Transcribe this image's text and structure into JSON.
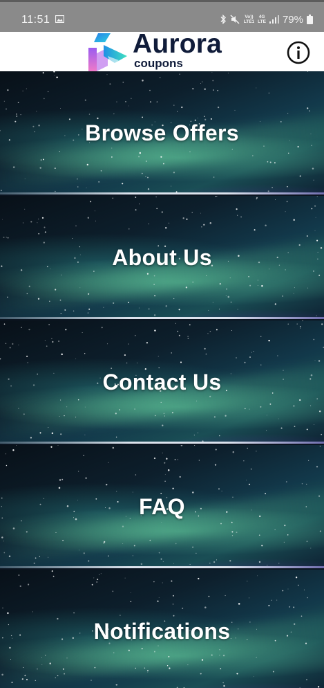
{
  "status_bar": {
    "time": "11:51",
    "battery": "79%",
    "network_volte_top": "Vo))",
    "network_volte_bottom": "LTE1",
    "network_4g_top": "4G",
    "network_4g_bottom": "LTE"
  },
  "header": {
    "brand": "Aurora",
    "brand_sub": "coupons"
  },
  "menu": {
    "items": [
      {
        "label": "Browse Offers"
      },
      {
        "label": "About Us"
      },
      {
        "label": "Contact Us"
      },
      {
        "label": "FAQ"
      },
      {
        "label": "Notifications"
      }
    ]
  },
  "colors": {
    "brand_text": "#101c3a",
    "status_bar_bg": "#8a8a8a",
    "header_bg": "#ffffff"
  }
}
